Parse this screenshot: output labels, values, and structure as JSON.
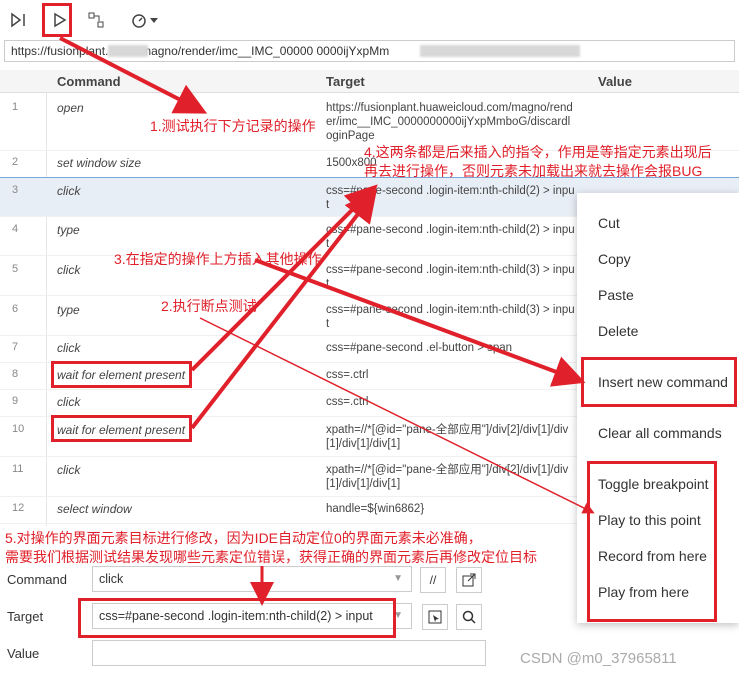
{
  "toolbar": {
    "icons": [
      "run-all-icon",
      "run-icon",
      "record-icon",
      "speed-icon"
    ]
  },
  "url_bar": "https://fusionplant.    .com/magno/render/imc__IMC_00000 0000ijYxpMm",
  "table": {
    "headers": {
      "command": "Command",
      "target": "Target",
      "value": "Value"
    },
    "rows": [
      {
        "num": "1",
        "command": "open",
        "target": "https://fusionplant.huaweicloud.com/magno/render/imc__IMC_0000000000ijYxpMmboG/discardloginPage"
      },
      {
        "num": "2",
        "command": "set window size",
        "target": "1500x800"
      },
      {
        "num": "3",
        "command": "click",
        "target": "css=#pane-second .login-item:nth-child(2) > input"
      },
      {
        "num": "4",
        "command": "type",
        "target": "css=#pane-second .login-item:nth-child(2) > input"
      },
      {
        "num": "5",
        "command": "click",
        "target": "css=#pane-second .login-item:nth-child(3) > input"
      },
      {
        "num": "6",
        "command": "type",
        "target": "css=#pane-second .login-item:nth-child(3) > input"
      },
      {
        "num": "7",
        "command": "click",
        "target": "css=#pane-second .el-button > span"
      },
      {
        "num": "8",
        "command": "wait for element present",
        "target": "css=.ctrl"
      },
      {
        "num": "9",
        "command": "click",
        "target": "css=.ctrl"
      },
      {
        "num": "10",
        "command": "wait for element present",
        "target": "xpath=//*[@id=\"pane-全部应用\"]/div[2]/div[1]/div[1]/div[1]/div[1]"
      },
      {
        "num": "11",
        "command": "click",
        "target": "xpath=//*[@id=\"pane-全部应用\"]/div[2]/div[1]/div[1]/div[1]/div[1]"
      },
      {
        "num": "12",
        "command": "select window",
        "target": "handle=${win6862}"
      }
    ]
  },
  "context_menu": {
    "items": [
      "Cut",
      "Copy",
      "Paste",
      "Delete",
      "Insert new command",
      "Clear all commands",
      "Toggle breakpoint",
      "Play to this point",
      "Record from here",
      "Play from here"
    ]
  },
  "editor": {
    "command_label": "Command",
    "command_value": "click",
    "target_label": "Target",
    "target_value": "css=#pane-second .login-item:nth-child(2) > input",
    "value_label": "Value",
    "value_value": ""
  },
  "annotations": {
    "a1": "1.测试执行下方记录的操作",
    "a2": "2.执行断点测试",
    "a3": "3.在指定的操作上方插入其他操作",
    "a4_line1": "4.这两条都是后来插入的指令，作用是等指定元素出现后",
    "a4_line2": "再去进行操作，否则元素未加载出来就去操作会报BUG",
    "a5_line1": "5.对操作的界面元素目标进行修改，因为IDE自动定位0的界面元素未必准确，",
    "a5_line2": "需要我们根据测试结果发现哪些元素定位错误，获得正确的界面元素后再修改定位目标"
  },
  "watermark": "CSDN @m0_37965811",
  "colors": {
    "annotation": "#e0202a",
    "selected_row": "#e8eef6"
  }
}
